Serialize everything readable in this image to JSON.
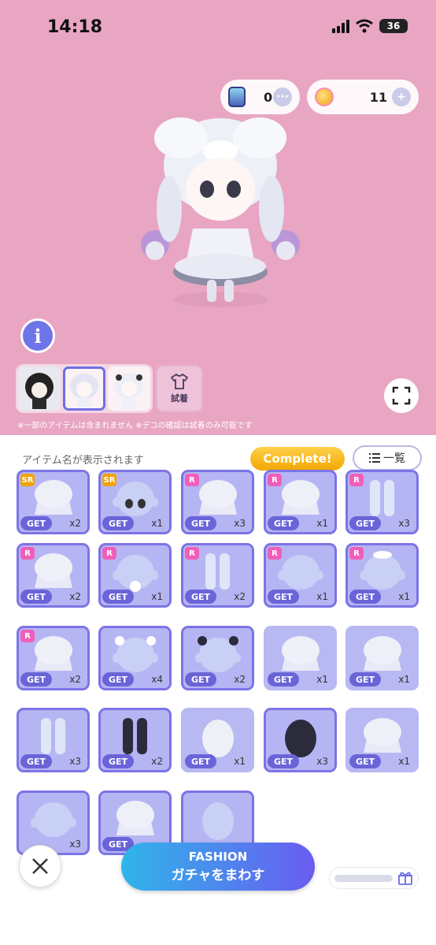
{
  "status": {
    "time": "14:18",
    "battery": "36"
  },
  "currency": {
    "gems": "0",
    "coins": "11",
    "gems_more_icon": "ellipsis-icon",
    "coins_add_icon": "plus-icon"
  },
  "preview": {
    "info_label": "i",
    "try_on_label": "試着",
    "note": "※一部のアイテムは含まれません ※デコの確認は試着のみ可能です"
  },
  "panel": {
    "item_name_placeholder": "アイテム名が表示されます",
    "complete_label": "Complete!",
    "list_label": "一覧"
  },
  "items": [
    {
      "rarity": "SR",
      "get": "GET",
      "count": "x2",
      "art": "hair-curls"
    },
    {
      "rarity": "SR",
      "get": "GET",
      "count": "x1",
      "art": "face-eyes"
    },
    {
      "rarity": "R",
      "get": "GET",
      "count": "x3",
      "art": "bow-headdress"
    },
    {
      "rarity": "R",
      "get": "GET",
      "count": "x1",
      "art": "dress-frill"
    },
    {
      "rarity": "R",
      "get": "GET",
      "count": "x3",
      "art": "side-ribbon"
    },
    {
      "rarity": "R",
      "get": "GET",
      "count": "x2",
      "art": "cage-skirt"
    },
    {
      "rarity": "R",
      "get": "GET",
      "count": "x1",
      "art": "chest-rose"
    },
    {
      "rarity": "R",
      "get": "GET",
      "count": "x2",
      "art": "boots"
    },
    {
      "rarity": "R",
      "get": "GET",
      "count": "x1",
      "art": "head-blank"
    },
    {
      "rarity": "R",
      "get": "GET",
      "count": "x1",
      "art": "hair-bow"
    },
    {
      "rarity": "R",
      "get": "GET",
      "count": "x2",
      "art": "body-ribbons"
    },
    {
      "rarity": "",
      "get": "GET",
      "count": "x4",
      "art": "head-bows-white"
    },
    {
      "rarity": "",
      "get": "GET",
      "count": "x2",
      "art": "head-bows-black"
    },
    {
      "rarity": "",
      "get": "GET",
      "count": "x1",
      "art": "sleeves"
    },
    {
      "rarity": "",
      "get": "GET",
      "count": "x1",
      "art": "skirt-white"
    },
    {
      "rarity": "",
      "get": "GET",
      "count": "x3",
      "art": "socks-skull"
    },
    {
      "rarity": "",
      "get": "GET",
      "count": "x2",
      "art": "socks-black"
    },
    {
      "rarity": "",
      "get": "GET",
      "count": "x1",
      "art": "top-white"
    },
    {
      "rarity": "",
      "get": "GET",
      "count": "x3",
      "art": "top-black"
    },
    {
      "rarity": "",
      "get": "GET",
      "count": "x1",
      "art": "shoes"
    },
    {
      "rarity": "",
      "get": "",
      "count": "x3",
      "art": "head-blank"
    },
    {
      "rarity": "",
      "get": "GET",
      "count": "",
      "art": "collar"
    },
    {
      "rarity": "",
      "get": "",
      "count": "",
      "art": "silhouette"
    }
  ],
  "actions": {
    "close_icon": "close-icon",
    "gacha_line1": "FASHION",
    "gacha_line2": "ガチャをまわす",
    "gift_icon": "gift-icon"
  }
}
